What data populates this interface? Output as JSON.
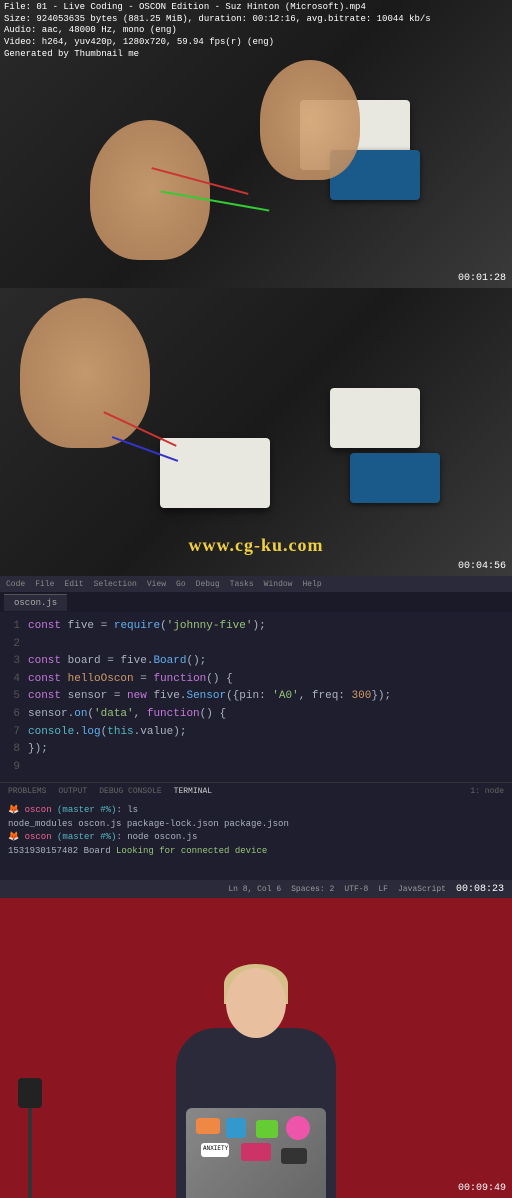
{
  "meta": {
    "l1": "File: 01 - Live Coding - OSCON Edition - Suz Hinton (Microsoft).mp4",
    "l2": "Size: 924053635 bytes (881.25 MiB), duration: 00:12:16, avg.bitrate: 10044 kb/s",
    "l3": "Audio: aac, 48000 Hz, mono (eng)",
    "l4": "Video: h264, yuv420p, 1280x720, 59.94 fps(r) (eng)",
    "l5": "Generated by Thumbnail me"
  },
  "watermark": "www.cg-ku.com",
  "timecodes": {
    "t1": "00:01:28",
    "t2": "00:04:56",
    "t3": "00:08:23",
    "t4": "00:09:49"
  },
  "editor": {
    "menu": {
      "m1": "Code",
      "m2": "File",
      "m3": "Edit",
      "m4": "Selection",
      "m5": "View",
      "m6": "Go",
      "m7": "Debug",
      "m8": "Tasks",
      "m9": "Window",
      "m10": "Help"
    },
    "tab": "oscon.js",
    "code": {
      "1": {
        "a": "const",
        "b": " five ",
        "c": "=",
        "d": " ",
        "e": "require",
        "f": "(",
        "g": "'johnny-five'",
        "h": ");"
      },
      "2": {
        "a": ""
      },
      "3": {
        "a": "const",
        "b": " board ",
        "c": "=",
        "d": " five.",
        "e": "Board",
        "f": "();"
      },
      "4": {
        "a": "const",
        "b": " ",
        "c": "helloOscon",
        "d": " ",
        "e": "=",
        "f": " ",
        "g": "function",
        "h": "() {"
      },
      "5": {
        "a": "  ",
        "b": "const",
        "c": " sensor ",
        "d": "=",
        "e": " ",
        "f": "new",
        "g": " five.",
        "h": "Sensor",
        "i": "({pin: ",
        "j": "'A0'",
        "k": ", freq: ",
        "l": "300",
        "m": "});"
      },
      "6": {
        "a": "  sensor.",
        "b": "on",
        "c": "(",
        "d": "'data'",
        "e": ", ",
        "f": "function",
        "g": "() {"
      },
      "7": {
        "a": "    ",
        "b": "console",
        "c": ".",
        "d": "log",
        "e": "(",
        "f": "this",
        "g": ".value);"
      },
      "8": {
        "a": "  });"
      },
      "9": {
        "a": ""
      }
    },
    "panels": {
      "p1": "PROBLEMS",
      "p2": "OUTPUT",
      "p3": "DEBUG CONSOLE",
      "p4": "TERMINAL"
    },
    "terminal": {
      "l1a": "🦊 oscon",
      "l1b": " (master #%)",
      "l1c": ": ls",
      "l2": "node_modules    oscon.js        package-lock.json package.json",
      "l3a": "🦊 oscon",
      "l3b": " (master #%)",
      "l3c": ": node oscon.js",
      "l4a": "1531930157482",
      "l4b": " Board ",
      "l4c": "Looking for connected device"
    },
    "status": {
      "s1": "Ln 8, Col 6",
      "s2": "Spaces: 2",
      "s3": "UTF-8",
      "s4": "LF",
      "s5": "JavaScript"
    },
    "termheader": "1: node"
  }
}
